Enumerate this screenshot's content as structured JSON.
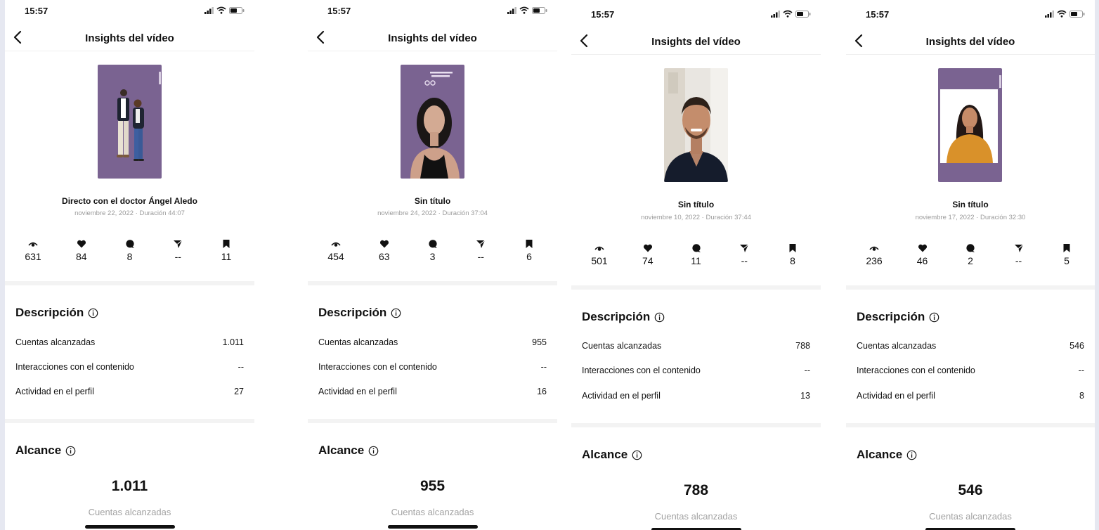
{
  "phones": [
    {
      "time": "15:57",
      "nav_title": "Insights del vídeo",
      "video_title": "Directo con el doctor Ángel Aledo",
      "video_meta": "noviembre 22, 2022 · Duración 44:07",
      "metrics": {
        "plays": "631",
        "likes": "84",
        "comments": "8",
        "shares": "--",
        "saves": "11"
      },
      "description": {
        "title": "Descripción",
        "rows": [
          {
            "label": "Cuentas alcanzadas",
            "value": "1.011"
          },
          {
            "label": "Interacciones con el contenido",
            "value": "--"
          },
          {
            "label": "Actividad en el perfil",
            "value": "27"
          }
        ]
      },
      "reach": {
        "title": "Alcance",
        "value": "1.011",
        "label": "Cuentas alcanzadas"
      }
    },
    {
      "time": "15:57",
      "nav_title": "Insights del vídeo",
      "video_title": "Sin título",
      "video_meta": "noviembre 24, 2022 · Duración 37:04",
      "metrics": {
        "plays": "454",
        "likes": "63",
        "comments": "3",
        "shares": "--",
        "saves": "6"
      },
      "description": {
        "title": "Descripción",
        "rows": [
          {
            "label": "Cuentas alcanzadas",
            "value": "955"
          },
          {
            "label": "Interacciones con el contenido",
            "value": "--"
          },
          {
            "label": "Actividad en el perfil",
            "value": "16"
          }
        ]
      },
      "reach": {
        "title": "Alcance",
        "value": "955",
        "label": "Cuentas alcanzadas"
      }
    },
    {
      "time": "15:57",
      "nav_title": "Insights del vídeo",
      "video_title": "Sin título",
      "video_meta": "noviembre 10, 2022 · Duración 37:44",
      "metrics": {
        "plays": "501",
        "likes": "74",
        "comments": "11",
        "shares": "--",
        "saves": "8"
      },
      "description": {
        "title": "Descripción",
        "rows": [
          {
            "label": "Cuentas alcanzadas",
            "value": "788"
          },
          {
            "label": "Interacciones con el contenido",
            "value": "--"
          },
          {
            "label": "Actividad en el perfil",
            "value": "13"
          }
        ]
      },
      "reach": {
        "title": "Alcance",
        "value": "788",
        "label": "Cuentas alcanzadas"
      }
    },
    {
      "time": "15:57",
      "nav_title": "Insights del vídeo",
      "video_title": "Sin título",
      "video_meta": "noviembre 17, 2022 · Duración 32:30",
      "metrics": {
        "plays": "236",
        "likes": "46",
        "comments": "2",
        "shares": "--",
        "saves": "5"
      },
      "description": {
        "title": "Descripción",
        "rows": [
          {
            "label": "Cuentas alcanzadas",
            "value": "546"
          },
          {
            "label": "Interacciones con el contenido",
            "value": "--"
          },
          {
            "label": "Actividad en el perfil",
            "value": "8"
          }
        ]
      },
      "reach": {
        "title": "Alcance",
        "value": "546",
        "label": "Cuentas alcanzadas"
      }
    }
  ],
  "colors": {
    "thumbnail_purple": "#7a6391",
    "shirt_yellow": "#d9912a"
  },
  "icons": {
    "back": "chevron-left-icon",
    "plays": "eye-icon",
    "likes": "heart-icon",
    "comments": "comment-bubble-icon",
    "shares": "send-paper-plane-icon",
    "saves": "bookmark-icon",
    "info": "info-circle-icon"
  }
}
